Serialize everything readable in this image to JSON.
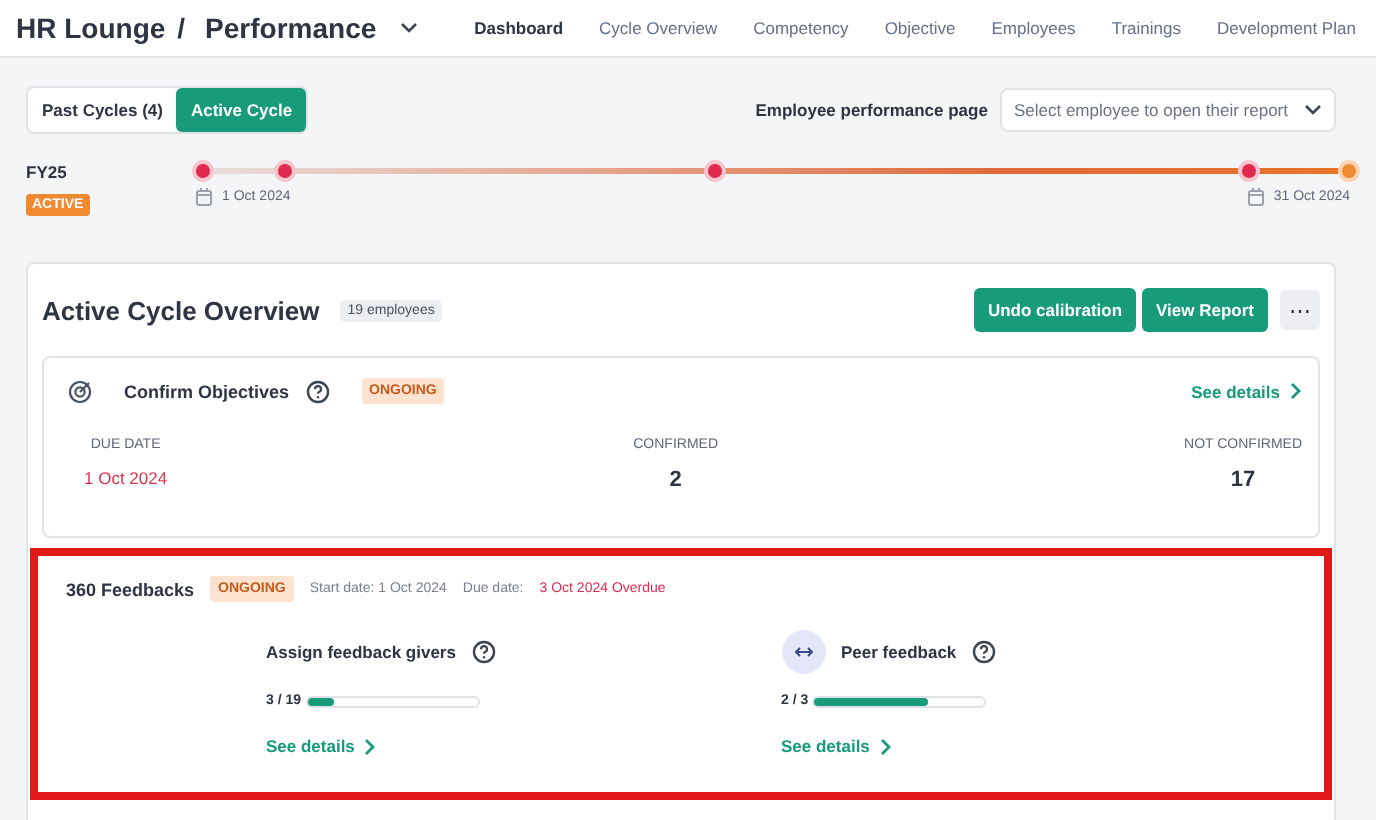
{
  "header": {
    "app": "HR Lounge",
    "separator": "/",
    "module": "Performance",
    "nav": [
      {
        "label": "Dashboard",
        "selected": true
      },
      {
        "label": "Cycle Overview",
        "selected": false
      },
      {
        "label": "Competency",
        "selected": false
      },
      {
        "label": "Objective",
        "selected": false
      },
      {
        "label": "Employees",
        "selected": false
      },
      {
        "label": "Trainings",
        "selected": false
      },
      {
        "label": "Development Plan",
        "selected": false
      }
    ]
  },
  "cycle_toggle": [
    {
      "label": "Past Cycles (4)",
      "selected": false
    },
    {
      "label": "Active Cycle",
      "selected": true
    }
  ],
  "employee_picker": {
    "label": "Employee performance page",
    "placeholder": "Select employee to open their report"
  },
  "timeline": {
    "name": "FY25",
    "status": "ACTIVE",
    "start": "1 Oct 2024",
    "end": "31 Oct 2024",
    "milestones": [
      {
        "current": false
      },
      {
        "current": false
      },
      {
        "current": false
      },
      {
        "current": false
      },
      {
        "current": true
      }
    ]
  },
  "overview": {
    "title": "Active Cycle Overview",
    "count": "19 employees",
    "buttons": [
      "Undo calibration",
      "View Report"
    ],
    "more": "⋯",
    "objectives": {
      "title": "Confirm Objectives",
      "status": "ONGOING",
      "link": "See details",
      "stats": [
        {
          "label": "DUE DATE",
          "value": "1 Oct 2024",
          "kind": "date"
        },
        {
          "label": "CONFIRMED",
          "value": "2",
          "kind": "number"
        },
        {
          "label": "NOT CONFIRMED",
          "value": "17",
          "kind": "number"
        }
      ]
    },
    "feedbacks": {
      "title": "360 Feedbacks",
      "status": "ONGOING",
      "start_label": "Start date:",
      "start": "1 Oct 2024",
      "due_label": "Due date:",
      "due": "3 Oct 2024 Overdue",
      "highlighted": true,
      "steps": [
        {
          "title": "Assign feedback givers",
          "progress": "3 / 19",
          "level": 0.16,
          "link": "See details",
          "icon": false
        },
        {
          "title": "Peer feedback",
          "progress": "2 / 3",
          "level": 0.67,
          "link": "See details",
          "icon": true
        }
      ]
    }
  }
}
